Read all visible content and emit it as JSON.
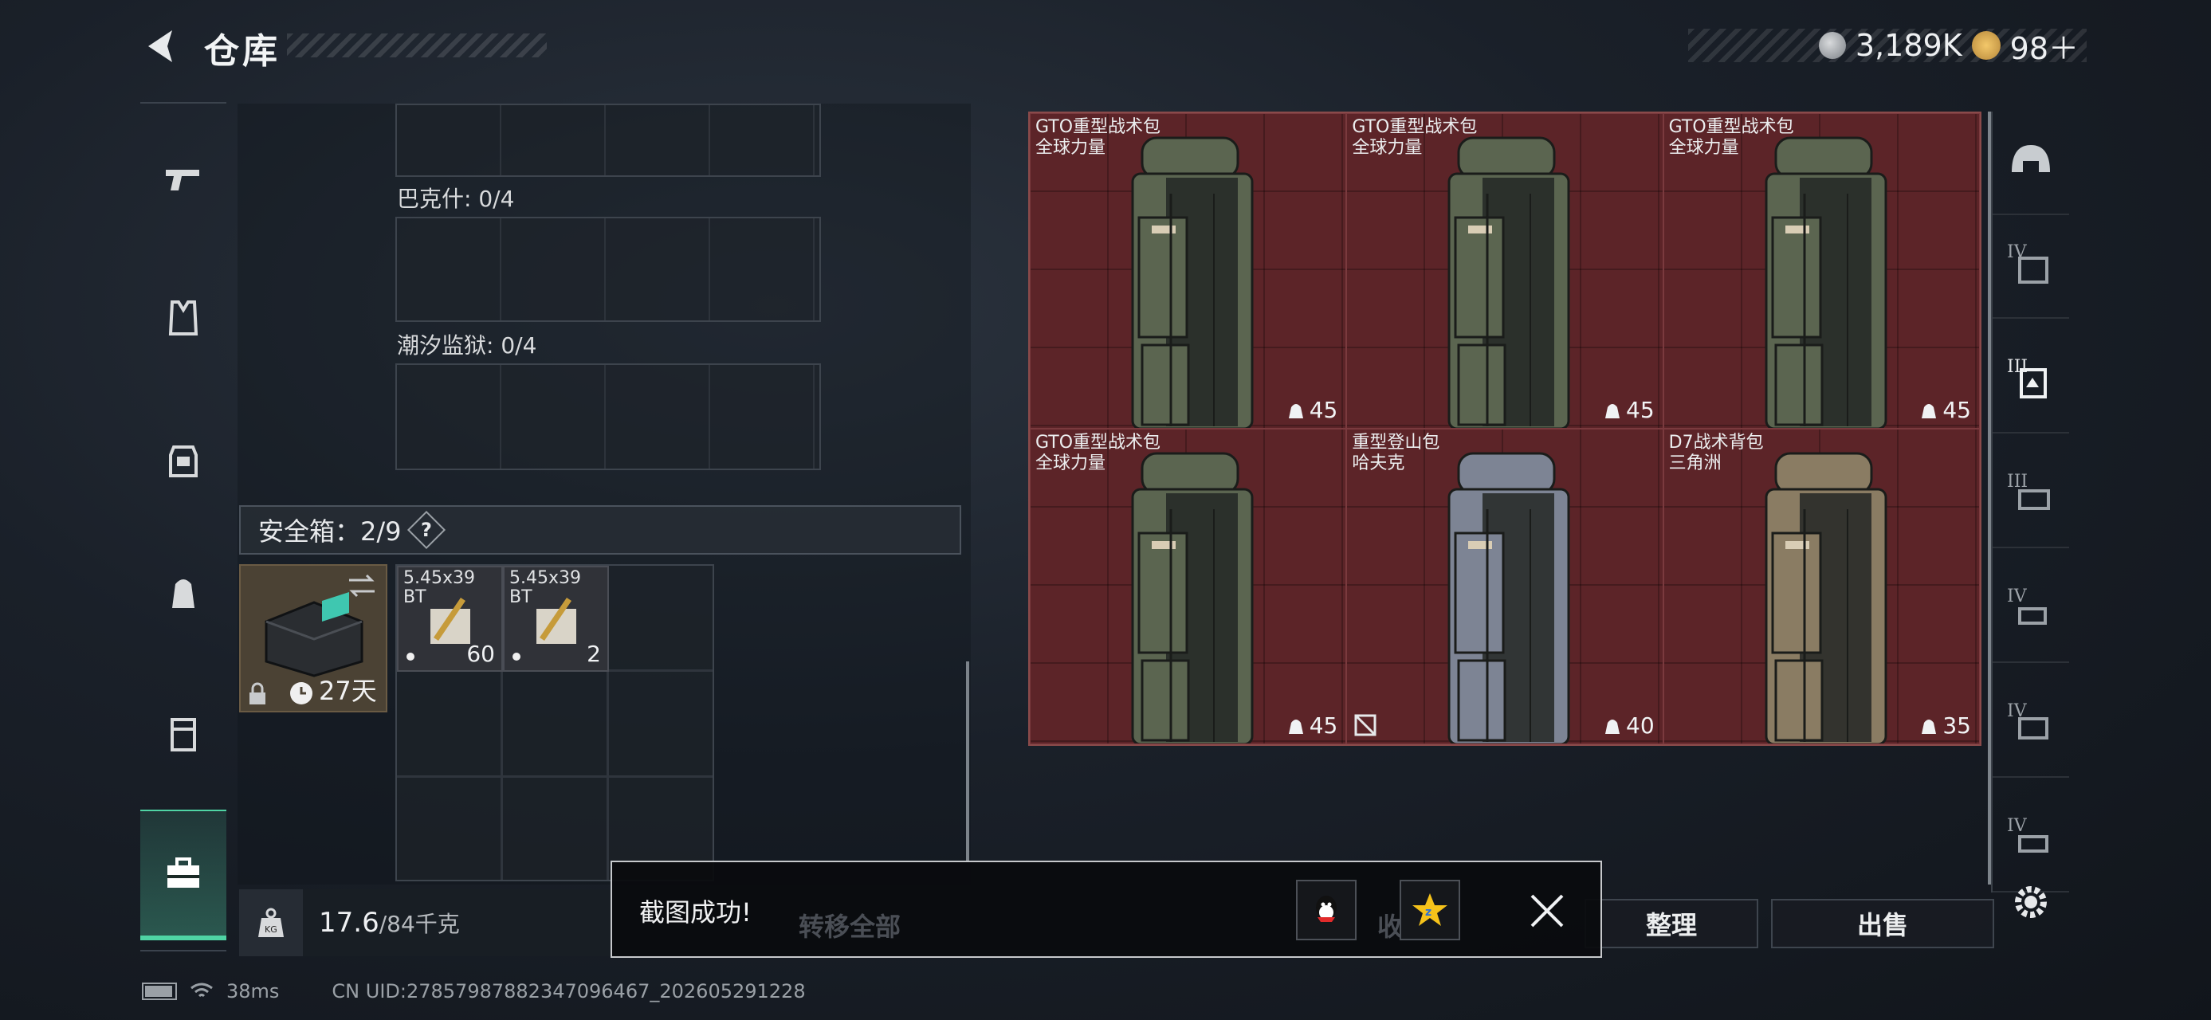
{
  "header": {
    "title": "仓库",
    "currency_coins": "3,189K",
    "currency_tickets": "98＋"
  },
  "left_tabs": [
    "pistol-icon",
    "vest-icon",
    "armor-icon",
    "backpack-icon",
    "container-icon",
    "toolbox-icon"
  ],
  "storage": {
    "slots": [
      {
        "label": "巴克什: 0/4"
      },
      {
        "label": "潮汐监狱: 0/4"
      }
    ],
    "safe_box": {
      "label": "安全箱：2/9",
      "help": "?",
      "timer": "27天",
      "items": [
        {
          "name_line1": "5.45x39",
          "name_line2": "BT",
          "count": "60"
        },
        {
          "name_line1": "5.45x39",
          "name_line2": "BT",
          "count": "2"
        }
      ]
    },
    "weight": {
      "current": "17.6",
      "max": "/84千克"
    }
  },
  "backpacks": [
    {
      "name": "GTO重型战术包",
      "origin": "全球力量",
      "capacity": "45",
      "color": "#5b6550"
    },
    {
      "name": "GTO重型战术包",
      "origin": "全球力量",
      "capacity": "45",
      "color": "#5b6550"
    },
    {
      "name": "GTO重型战术包",
      "origin": "全球力量",
      "capacity": "45",
      "color": "#5b6550"
    },
    {
      "name": "GTO重型战术包",
      "origin": "全球力量",
      "capacity": "45",
      "color": "#5b6550"
    },
    {
      "name": "重型登山包",
      "origin": "哈夫克",
      "capacity": "40",
      "color": "#7d8494"
    },
    {
      "name": "D7战术背包",
      "origin": "三角洲",
      "capacity": "35",
      "color": "#8a7c63"
    }
  ],
  "right_tabs": {
    "levels": [
      "IV",
      "III",
      "III",
      "IV",
      "IV",
      "IV"
    ]
  },
  "buttons": {
    "transfer_all": "转移全部",
    "collect": "收藏",
    "organize": "整理",
    "sell": "出售"
  },
  "toast": {
    "message": "截图成功!"
  },
  "footer": {
    "ping": "38ms",
    "uid": "CN UID:27857987882347096467_202605291228"
  }
}
